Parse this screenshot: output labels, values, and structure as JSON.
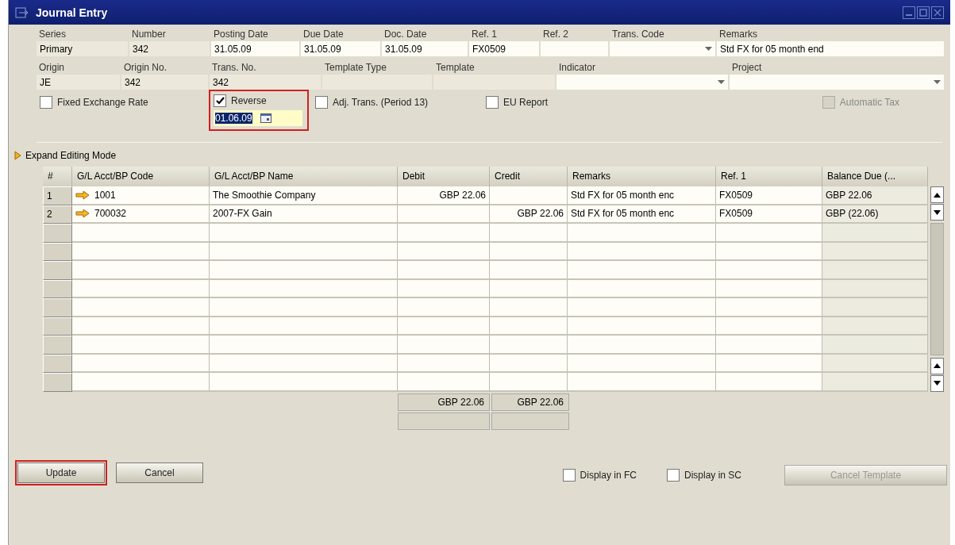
{
  "window": {
    "title": "Journal Entry"
  },
  "header_row_1": [
    {
      "label": "Series",
      "value": "Primary",
      "kind": "text",
      "editable": false
    },
    {
      "label": "Number",
      "value": "342",
      "kind": "text",
      "editable": false
    },
    {
      "label": "Posting Date",
      "value": "31.05.09",
      "kind": "text",
      "editable": true
    },
    {
      "label": "Due Date",
      "value": "31.05.09",
      "kind": "text",
      "editable": true
    },
    {
      "label": "Doc. Date",
      "value": "31.05.09",
      "kind": "text",
      "editable": true
    },
    {
      "label": "Ref. 1",
      "value": "FX0509",
      "kind": "text",
      "editable": true
    },
    {
      "label": "Ref. 2",
      "kind": "text",
      "editable": true
    },
    {
      "label": "Trans. Code",
      "kind": "dropdown",
      "editable": true
    },
    {
      "label": "Remarks",
      "value": "Std FX for 05 month end",
      "kind": "text",
      "editable": true
    }
  ],
  "header_row_2": [
    {
      "label": "Origin",
      "value": "JE",
      "kind": "text",
      "editable": false
    },
    {
      "label": "Origin No.",
      "value": "342",
      "kind": "text",
      "editable": false
    },
    {
      "label": "Trans. No.",
      "value": "342",
      "kind": "text",
      "editable": false
    },
    {
      "label": "Template Type",
      "kind": "text",
      "editable": false
    },
    {
      "label": "Template",
      "kind": "text",
      "editable": false
    },
    {
      "label": "Indicator",
      "kind": "dropdown",
      "editable": true
    },
    {
      "label": "Project",
      "kind": "dropdown",
      "editable": true
    }
  ],
  "options": [
    {
      "label": "Fixed Exchange Rate",
      "checked": false,
      "disabled": false,
      "highlighted": false
    },
    {
      "label": "Reverse",
      "checked": true,
      "disabled": false,
      "highlighted": true,
      "date": "01.06.09"
    },
    {
      "label": "Adj. Trans. (Period 13)",
      "checked": false,
      "disabled": false,
      "highlighted": false
    },
    {
      "label": "EU Report",
      "checked": false,
      "disabled": false,
      "highlighted": false
    },
    {
      "label": "Automatic Tax",
      "checked": false,
      "disabled": true,
      "highlighted": false
    }
  ],
  "expand_link": "Expand Editing Mode",
  "table": {
    "columns": [
      "#",
      "G/L Acct/BP Code",
      "G/L Acct/BP Name",
      "Debit",
      "Credit",
      "Remarks",
      "Ref. 1",
      "Balance Due (..."
    ],
    "rows": [
      [
        "1",
        "1001",
        "The Smoothie Company",
        "GBP 22.06",
        "",
        "Std FX for 05 month enc",
        "FX0509",
        "GBP  22.06"
      ],
      [
        "2",
        "700032",
        "2007-FX Gain",
        "",
        "GBP 22.06",
        "Std FX for 05 month enc",
        "FX0509",
        "GBP (22.06)"
      ]
    ],
    "totals": {
      "debit": "GBP 22.06",
      "credit": "GBP 22.06"
    }
  },
  "buttons": [
    {
      "label": "Update",
      "highlighted": true
    },
    {
      "label": "Cancel",
      "highlighted": false
    }
  ],
  "display_options": [
    {
      "label": "Display in FC",
      "checked": false
    },
    {
      "label": "Display in SC",
      "checked": false
    }
  ],
  "cancel_template": {
    "label": "Cancel Template",
    "disabled": true
  }
}
